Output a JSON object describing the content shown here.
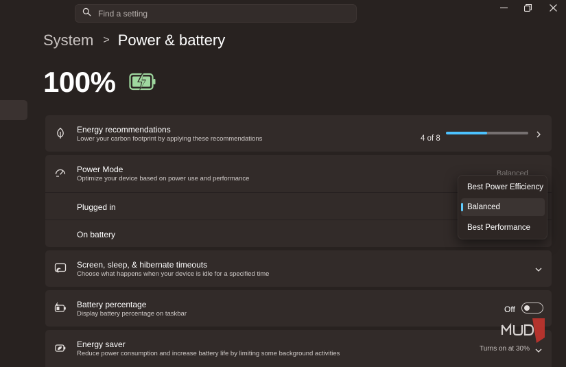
{
  "search": {
    "placeholder": "Find a setting"
  },
  "window_controls": {
    "minimize": "minimize-icon",
    "restore": "restore-icon",
    "close": "close-icon"
  },
  "breadcrumb": {
    "root": "System",
    "separator": ">",
    "current": "Power & battery"
  },
  "battery": {
    "percent": "100%",
    "icon": "battery-charging-icon"
  },
  "energy_recommendations": {
    "title": "Energy recommendations",
    "description": "Lower your carbon footprint by applying these recommendations",
    "progress_label": "4 of 8",
    "progress_value": 0.5
  },
  "power_mode": {
    "title": "Power Mode",
    "description": "Optimize your device based on power use and performance",
    "current_value": "Balanced",
    "plugged_in_label": "Plugged in",
    "on_battery_label": "On battery",
    "options": [
      "Best Power Efficiency",
      "Balanced",
      "Best Performance"
    ],
    "selected_option": "Balanced"
  },
  "screen_sleep": {
    "title": "Screen, sleep, & hibernate timeouts",
    "description": "Choose what happens when your device is idle for a specified time"
  },
  "battery_percentage": {
    "title": "Battery percentage",
    "description": "Display battery percentage on taskbar",
    "toggle_label": "Off"
  },
  "energy_saver": {
    "title": "Energy saver",
    "description": "Reduce power consumption and increase battery life by limiting some background activities",
    "status": "Turns on at 30%"
  },
  "colors": {
    "background": "#282220",
    "card": "#322b29",
    "accent": "#4cc2ff",
    "battery_fill": "#9fd89f"
  }
}
